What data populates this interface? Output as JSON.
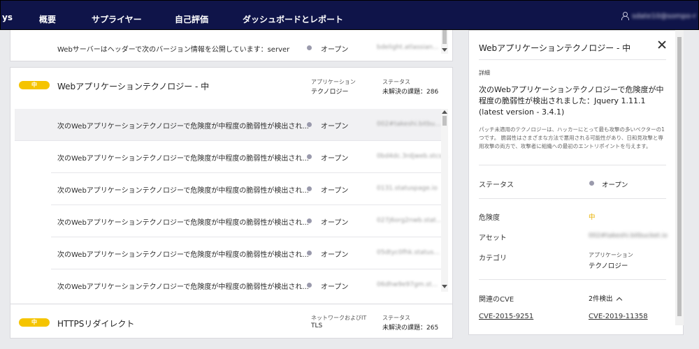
{
  "nav": {
    "brand": "ys",
    "items": [
      "概要",
      "サプライヤー",
      "自己評価",
      "ダッシュボードとレポート"
    ],
    "user": "sdate10@sompo-r"
  },
  "top_card": {
    "finding": "Webサーバーはヘッダーで次のバージョン情報を公開しています：server",
    "status": "オープン",
    "asset": "bdelight.atlassian..."
  },
  "group_medium": {
    "badge": "中",
    "title": "Webアプリケーションテクノロジー - 中",
    "category_label": "アプリケーション",
    "category_value": "テクノロジー",
    "status_label": "ステータス",
    "status_value": "未解決の課題：286",
    "rows": [
      {
        "text": "次のWebアプリケーションテクノロジーで危険度が中程度の脆弱性が検出され...",
        "status": "オープン",
        "asset": "002#takeshi.bitbu..."
      },
      {
        "text": "次のWebアプリケーションテクノロジーで危険度が中程度の脆弱性が検出され...",
        "status": "オープン",
        "asset": "0bd4dc.3rdjweb.stcs..."
      },
      {
        "text": "次のWebアプリケーションテクノロジーで危険度が中程度の脆弱性が検出され...",
        "status": "オープン",
        "asset": "0131.statuspage.io"
      },
      {
        "text": "次のWebアプリケーションテクノロジーで危険度が中程度の脆弱性が検出され...",
        "status": "オープン",
        "asset": "027j6org2nwb.stat..."
      },
      {
        "text": "次のWebアプリケーションテクノロジーで危険度が中程度の脆弱性が検出され...",
        "status": "オープン",
        "asset": "05dtyc0fhk.status..."
      },
      {
        "text": "次のWebアプリケーションテクノロジーで危険度が中程度の脆弱性が検出され...",
        "status": "オープン",
        "asset": "06dhw9e97gm.st..."
      }
    ]
  },
  "group_https": {
    "badge": "中",
    "title": "HTTPSリダイレクト",
    "category_label": "ネットワークおよびIT",
    "category_value": "TLS",
    "status_label": "ステータス",
    "status_value": "未解決の課題：265"
  },
  "detail": {
    "title": "Webアプリケーションテクノロジー - 中",
    "section_label": "詳細",
    "description": "次のWebアプリケーションテクノロジーで危険度が中程度の脆弱性が検出されました：Jquery 1.11.1 (latest version - 3.4.1)",
    "explanation": "パッチ未適用のテクノロジーは、ハッカーにとって最も攻撃の多いベクターの1つです。 脆弱性はさまざまな方法で悪用される可能性があり、日和見攻撃と専用攻撃の両方で、攻撃者に組織への最初のエントリポイントを与えます。",
    "status_label": "ステータス",
    "status_value": "オープン",
    "severity_label": "危険度",
    "severity_value": "中",
    "asset_label": "アセット",
    "asset_value": "002#takeshi.bitbucket.io",
    "category_label": "カテゴリ",
    "category_line1": "アプリケーション",
    "category_line2": "テクノロジー",
    "cve_label": "関連のCVE",
    "cve_count": "2件検出",
    "cves": [
      "CVE-2015-9251",
      "CVE-2019-11358"
    ]
  },
  "colors": {
    "nav_bg": "#0f1449",
    "badge_medium": "#f5c400",
    "status_dot": "#9a9aac"
  }
}
